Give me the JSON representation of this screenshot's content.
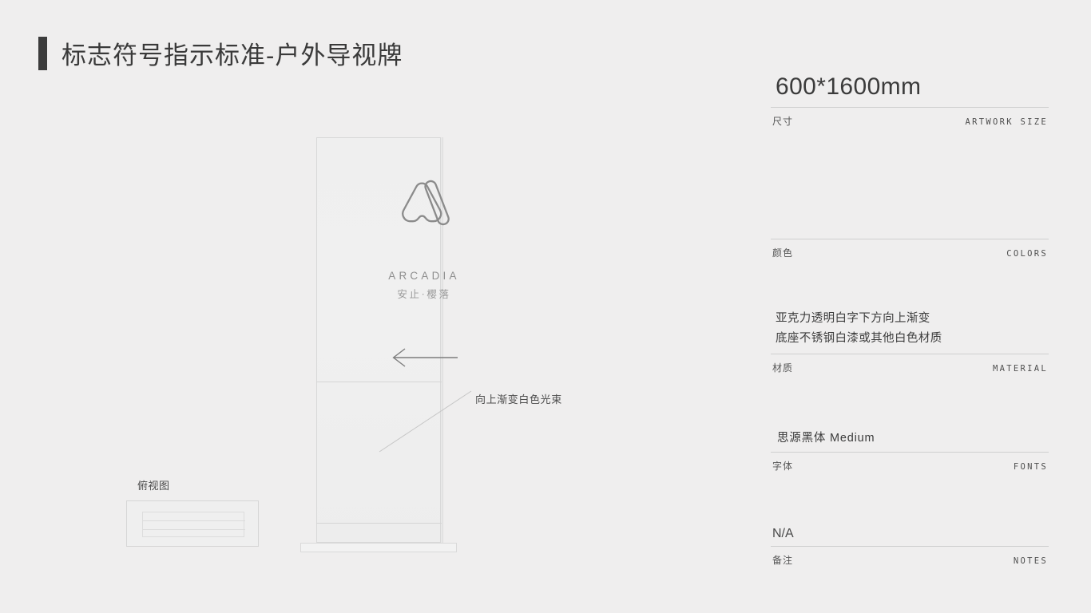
{
  "page": {
    "title": "标志符号指示标准-户外导视牌",
    "background_color": "#efeeee",
    "accent_color": "#3c3c3c"
  },
  "sign": {
    "logo_mark_name": "arcadia-logo-mark",
    "brand_en": "ARCADIA",
    "brand_cn": "安止·樱落",
    "direction_arrow": "left-arrow",
    "callout": "向上渐变白色光束"
  },
  "topview": {
    "label": "俯视图"
  },
  "spec": {
    "rows": [
      {
        "value": "600*1600mm",
        "label_cn": "尺寸",
        "label_en": "ARTWORK SIZE"
      },
      {
        "value": "",
        "label_cn": "颜色",
        "label_en": "COLORS"
      },
      {
        "value_line1": "亚克力透明白字下方向上渐变",
        "value_line2": "底座不锈钢白漆或其他白色材质",
        "label_cn": "材质",
        "label_en": "MATERIAL"
      },
      {
        "value": "思源黑体 Medium",
        "label_cn": "字体",
        "label_en": "FONTS"
      },
      {
        "value": "N/A",
        "label_cn": "备注",
        "label_en": "NOTES"
      }
    ]
  }
}
